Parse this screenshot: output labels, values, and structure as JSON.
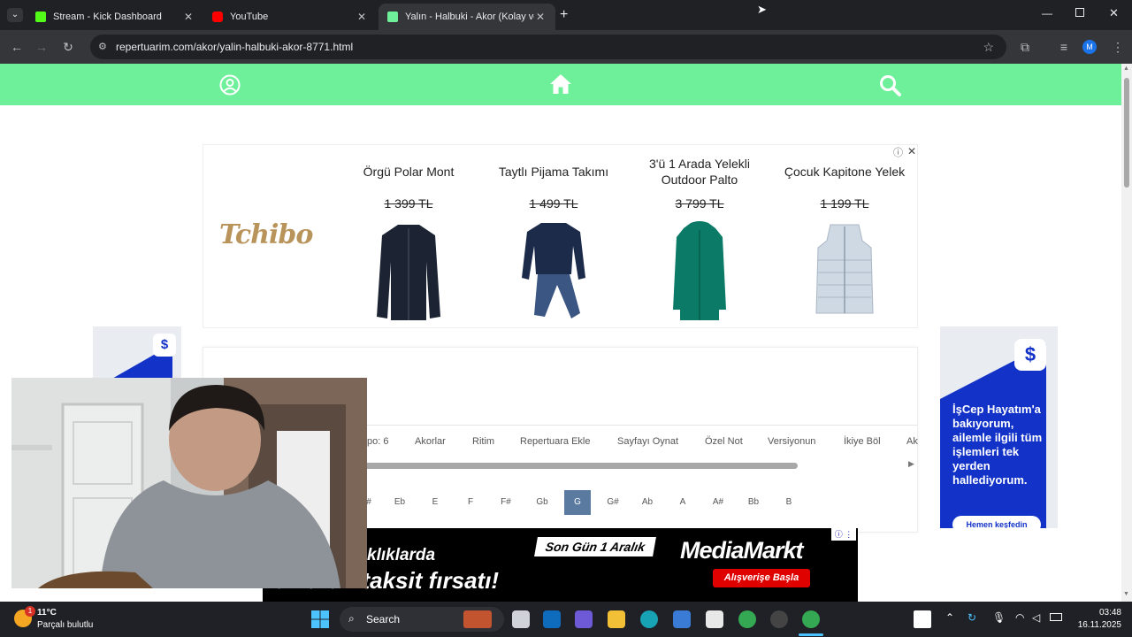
{
  "browser": {
    "tabs": [
      {
        "title": "Stream - Kick Dashboard",
        "favicon_color": "#53fc18"
      },
      {
        "title": "YouTube",
        "favicon_color": "#ff0000"
      },
      {
        "title": "Yalın - Halbuki - Akor (Kolay ve",
        "favicon_color": "#6ef09a"
      }
    ],
    "url": "repertuarim.com/akor/yalin-halbuki-akor-8771.html",
    "profile_initial": "M"
  },
  "site": {
    "nav_icons": [
      "user-icon",
      "home-icon",
      "search-icon"
    ],
    "nav_color": "#6ef09a"
  },
  "ad": {
    "brand": "Tchibo",
    "products": [
      {
        "name": "Örgü Polar Mont",
        "price": "1 399 TL"
      },
      {
        "name": "Taytlı Pijama Takımı",
        "price": "1 499 TL"
      },
      {
        "name": "3'ü 1 Arada Yelekli Outdoor Palto",
        "price": "3 799 TL"
      },
      {
        "name": "Çocuk Kapitone Yelek",
        "price": "1 199 TL"
      }
    ]
  },
  "side_ad": {
    "brand": "İşCep",
    "text": "İşCep Hayatım'a bakıyorum, ailemle ilgili tüm işlemleri tek yerden hallediyorum.",
    "cta": "Hemen keşfedin"
  },
  "chord_menu": [
    "po: 6",
    "Akorlar",
    "Ritim",
    "Repertuara Ekle",
    "Sayfayı Oynat",
    "Özel Not",
    "Versiyonun",
    "İkiye Böl",
    "Ak"
  ],
  "keys": {
    "items": [
      "#",
      "Eb",
      "E",
      "F",
      "F#",
      "Gb",
      "G",
      "G#",
      "Ab",
      "A",
      "A#",
      "Bb",
      "B"
    ],
    "selected": "G"
  },
  "bottom_ad": {
    "line1": "klıklarda",
    "line2": "'a varan taksit fırsatı!",
    "badge": "Son Gün 1 Aralık",
    "brand": "MediaMarkt",
    "cta": "Alışverişe Başla"
  },
  "taskbar": {
    "weather_temp": "11°C",
    "weather_desc": "Parçalı bulutlu",
    "weather_badge": "1",
    "search_placeholder": "Search",
    "time": "03:48",
    "date": "16.11.2025"
  }
}
